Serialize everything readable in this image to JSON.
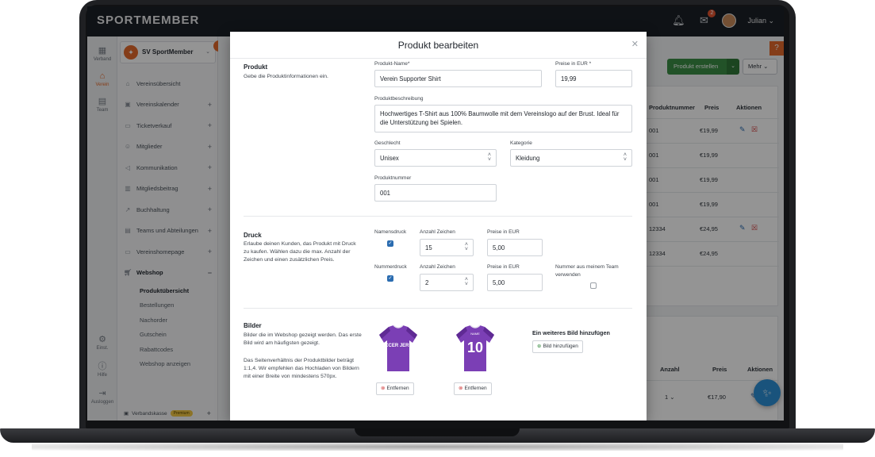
{
  "app": {
    "logo": "SPORTMEMBER",
    "user_name": "Julian",
    "mail_badge": "2"
  },
  "rail": [
    {
      "label": "Verband",
      "icon": "grid-icon"
    },
    {
      "label": "Verein",
      "icon": "club-icon"
    },
    {
      "label": "Team",
      "icon": "team-icon"
    },
    {
      "label": "Einst.",
      "icon": "gear-icon"
    },
    {
      "label": "Hilfe",
      "icon": "help-icon"
    },
    {
      "label": "Ausloggen",
      "icon": "logout-icon"
    }
  ],
  "sidebar": {
    "club_name": "SV SportMember",
    "items": [
      {
        "label": "Vereinsübersicht",
        "icon": "home-icon",
        "plus": ""
      },
      {
        "label": "Vereinskalender",
        "icon": "calendar-icon",
        "plus": "+"
      },
      {
        "label": "Ticketverkauf",
        "icon": "ticket-icon",
        "plus": "+"
      },
      {
        "label": "Mitglieder",
        "icon": "members-icon",
        "plus": "+"
      },
      {
        "label": "Kommunikation",
        "icon": "megaphone-icon",
        "plus": "+"
      },
      {
        "label": "Mitgliedsbeitrag",
        "icon": "fee-icon",
        "plus": "+"
      },
      {
        "label": "Buchhaltung",
        "icon": "chart-icon",
        "plus": "+"
      },
      {
        "label": "Teams und Abteilungen",
        "icon": "teams-icon",
        "plus": "+"
      },
      {
        "label": "Vereinshomepage",
        "icon": "website-icon",
        "plus": "+"
      },
      {
        "label": "Webshop",
        "icon": "cart-icon",
        "plus": "−"
      }
    ],
    "webshop_sub": [
      "Produktübersicht",
      "Bestellungen",
      "Nachorder",
      "Gutschein",
      "Rabattcodes",
      "Webshop anzeigen"
    ],
    "verbandskasse": "Verbandskasse",
    "premium_badge": "Premium"
  },
  "background": {
    "create_button": "Produkt erstellen",
    "more_button": "Mehr",
    "table1_headers": [
      "Produktnummer",
      "Preis",
      "Aktionen"
    ],
    "table1_rows": [
      {
        "nr": "001",
        "price": "€19,99",
        "actions": true
      },
      {
        "nr": "001",
        "price": "€19,99",
        "actions": false
      },
      {
        "nr": "001",
        "price": "€19,99",
        "actions": false
      },
      {
        "nr": "001",
        "price": "€19,99",
        "actions": false
      },
      {
        "nr": "12334",
        "price": "€24,95",
        "actions": true
      },
      {
        "nr": "12334",
        "price": "€24,95",
        "actions": false
      }
    ],
    "table2_headers": [
      "Anzahl",
      "Preis",
      "Aktionen"
    ],
    "table2_row": {
      "qty": "1",
      "price": "€17,90"
    }
  },
  "modal": {
    "title": "Produkt bearbeiten",
    "produkt": {
      "title": "Produkt",
      "desc": "Gebe die Produktinformationen ein.",
      "name_label": "Produkt-Name*",
      "name_value": "Verein Supporter Shirt",
      "price_label": "Preise in EUR *",
      "price_value": "19,99",
      "desc_label": "Produktbeschreibung",
      "desc_value": "Hochwertiges T-Shirt aus 100% Baumwolle mit dem Vereinslogo auf der Brust. Ideal für die Unterstützung bei Spielen.",
      "gender_label": "Geschlecht",
      "gender_value": "Unisex",
      "category_label": "Kategorie",
      "category_value": "Kleidung",
      "number_label": "Produktnummer",
      "number_value": "001"
    },
    "druck": {
      "title": "Druck",
      "desc": "Erlaube deinen Kunden, das Produkt mit Druck zu kaufen. Wählen dazu die max. Anzahl der Zeichen und einen zusätzlichen Preis.",
      "name_print_label": "Namensdruck",
      "name_print_checked": true,
      "chars_label": "Anzahl Zeichen",
      "name_chars": "15",
      "price_label": "Preise in EUR",
      "name_price": "5,00",
      "number_print_label": "Nummerdruck",
      "number_print_checked": true,
      "number_chars": "2",
      "number_price": "5,00",
      "team_numbers_label": "Nummer aus meinem Team verwenden",
      "team_numbers_checked": false
    },
    "bilder": {
      "title": "Bilder",
      "desc1": "Bilder die im Webshop gezeigt werden. Das erste Bild wird am häufigsten gezeigt.",
      "desc2": "Das Seitenverhältnis der Produktbilder beträgt 1:1,4. Wir empfehlen das Hochladen von Bildern mit einer Breite von mindestens 570px.",
      "remove_label": "Entfernen",
      "add_title": "Ein weiteres Bild hinzufügen",
      "add_button": "Bild hinzufügen",
      "jersey1_text": "SOCCER JERSEY",
      "jersey2_text": "NAME",
      "jersey2_number": "10"
    }
  },
  "colors": {
    "accent_orange": "#e4692b",
    "green": "#3c8e45",
    "jersey_purple": "#7b3fb5"
  }
}
